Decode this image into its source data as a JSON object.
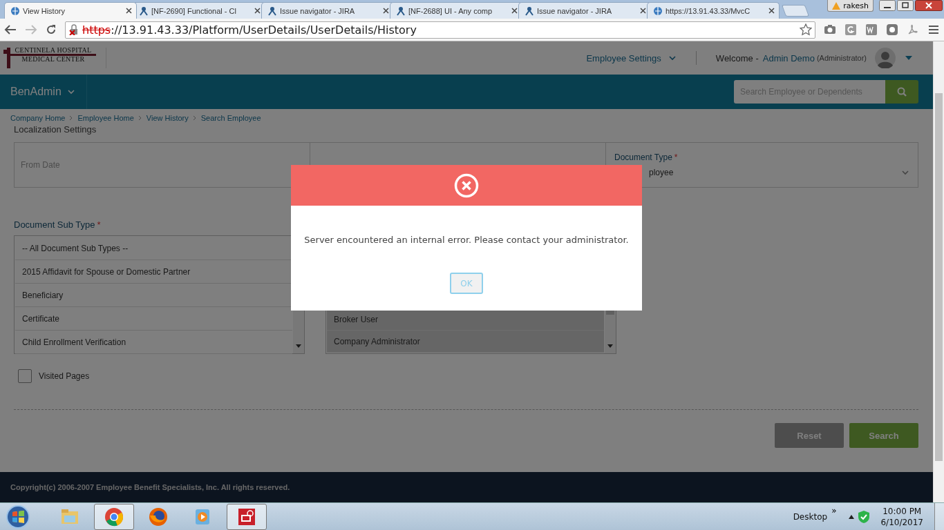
{
  "browser": {
    "tabs": [
      {
        "title": "View History",
        "selected": true
      },
      {
        "title": "[NF-2690] Functional - Cl",
        "selected": false
      },
      {
        "title": "Issue navigator - JIRA",
        "selected": false
      },
      {
        "title": "[NF-2688] UI - Any comp",
        "selected": false
      },
      {
        "title": "Issue navigator - JIRA",
        "selected": false
      },
      {
        "title": "https://13.91.43.33/MvcC",
        "selected": false
      }
    ],
    "profile": "rakesh",
    "address_scheme": "https",
    "address_rest": "://13.91.43.33/Platform/UserDetails/UserDetails/History"
  },
  "header": {
    "logo_line_1": "CENTINELA HOSPITAL",
    "logo_line_2": "MEDICAL CENTER",
    "employee_settings": "Employee Settings",
    "welcome": "Welcome -",
    "user_name": "Admin Demo",
    "user_role": "(Administrator)"
  },
  "nav": {
    "brand": "BenAdmin",
    "search": {
      "placeholder": "Search Employee or Dependents"
    }
  },
  "breadcrumbs": [
    "Company Home",
    "Employee Home",
    "View History",
    "Search Employee"
  ],
  "section_title": "Localization Settings",
  "filters": {
    "from_date": {
      "placeholder": "From Date"
    },
    "document_type": {
      "label": "Document Type",
      "required_mark": "*",
      "value": "ployee"
    }
  },
  "sub_type": {
    "label": "Document Sub Type",
    "required_mark": "*",
    "options": [
      {
        "label": "-- All Document Sub Types --",
        "selected": false
      },
      {
        "label": "2015 Affidavit for Spouse or Domestic Partner",
        "selected": false
      },
      {
        "label": "Beneficiary",
        "selected": false
      },
      {
        "label": "Certificate",
        "selected": false
      },
      {
        "label": "Child Enrollment Verification",
        "selected": false
      }
    ]
  },
  "roles": {
    "options": [
      {
        "label": "Broker User",
        "selected": true
      },
      {
        "label": "Company Administrator",
        "selected": true
      }
    ]
  },
  "visited_pages": {
    "label": "Visited Pages",
    "checked": false
  },
  "buttons": [
    {
      "label": "Reset",
      "kind": "reset"
    },
    {
      "label": "Search",
      "kind": "search"
    }
  ],
  "footer": "Copyright(c) 2006-2007 Employee Benefit Specialists, Inc. All rights reserved.",
  "dialog": {
    "message": "Server encountered an internal error. Please contact your administrator.",
    "button": "OK"
  },
  "taskbar": {
    "desktop": "Desktop",
    "chevron": "»",
    "time": "10:00 PM",
    "date": "6/10/2017"
  }
}
